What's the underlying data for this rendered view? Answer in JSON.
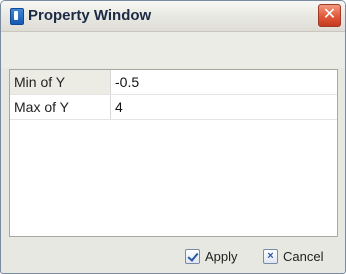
{
  "window": {
    "title": "Property Window",
    "close_glyph": "✕"
  },
  "properties": [
    {
      "name": "Min of Y",
      "value": "-0.5",
      "selected": true
    },
    {
      "name": "Max of Y",
      "value": "4",
      "selected": false
    }
  ],
  "buttons": {
    "apply_label": "Apply",
    "cancel_label": "Cancel",
    "apply_icon": "checkmark-icon",
    "cancel_icon": "x-icon"
  },
  "colors": {
    "title_text": "#1c2a44",
    "close_button": "#e0583a",
    "selected_row": "#ecebe4"
  }
}
